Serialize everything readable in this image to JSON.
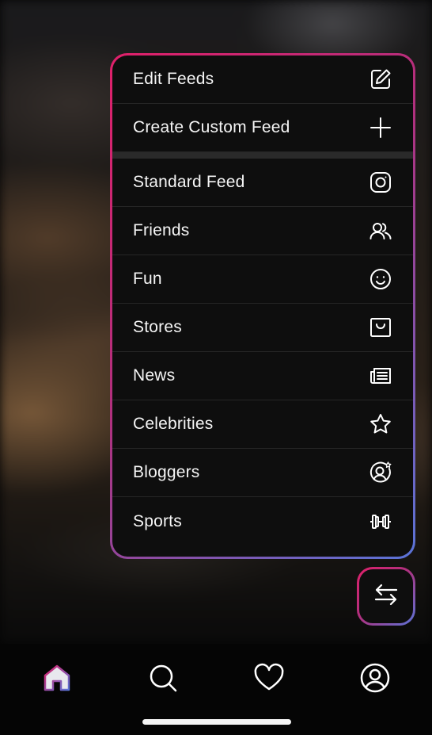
{
  "menu": {
    "top_items": [
      {
        "label": "Edit Feeds",
        "icon": "edit-icon"
      },
      {
        "label": "Create Custom Feed",
        "icon": "plus-icon"
      }
    ],
    "feed_items": [
      {
        "label": "Standard Feed",
        "icon": "instagram-icon"
      },
      {
        "label": "Friends",
        "icon": "friends-icon"
      },
      {
        "label": "Fun",
        "icon": "smiley-icon"
      },
      {
        "label": "Stores",
        "icon": "shopping-bag-icon"
      },
      {
        "label": "News",
        "icon": "newspaper-icon"
      },
      {
        "label": "Celebrities",
        "icon": "star-icon"
      },
      {
        "label": "Bloggers",
        "icon": "blogger-icon"
      },
      {
        "label": "Sports",
        "icon": "dumbbell-icon"
      }
    ]
  },
  "fab": {
    "icon": "swap-arrows-icon"
  },
  "tabbar": {
    "tabs": [
      {
        "name": "home",
        "icon": "home-icon",
        "active": true
      },
      {
        "name": "search",
        "icon": "search-icon",
        "active": false
      },
      {
        "name": "likes",
        "icon": "heart-icon",
        "active": false
      },
      {
        "name": "profile",
        "icon": "profile-icon",
        "active": false
      }
    ]
  },
  "colors": {
    "gradient_start": "#e0206a",
    "gradient_mid": "#b0307e",
    "gradient_end": "#5a74d8",
    "menu_bg": "#0e0e0e",
    "text": "#f5f5f5"
  }
}
